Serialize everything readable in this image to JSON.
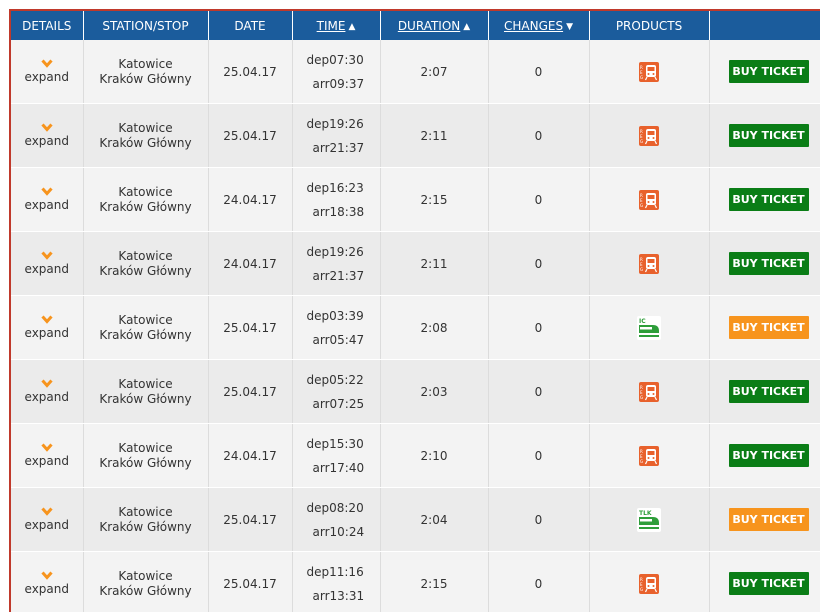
{
  "columns": {
    "details": "DETAILS",
    "station": "STATION/STOP",
    "date": "DATE",
    "time": "TIME",
    "duration": "DURATION",
    "changes": "CHANGES",
    "products": "PRODUCTS",
    "buy": ""
  },
  "colors": {
    "header_bg": "#1b5c9c",
    "green_button": "#0a7d16",
    "orange_button": "#f7941d",
    "chevron": "#f7941d"
  },
  "rows": [
    {
      "expand": "expand",
      "from": "Katowice",
      "to": "Kraków Główny",
      "date": "25.04.17",
      "dep": "dep07:30",
      "arr": "arr09:37",
      "duration": "2:07",
      "changes": "0",
      "product": "REG",
      "product_icon": "reg-train-icon",
      "buy": "BUY TICKET",
      "buy_style": "green"
    },
    {
      "expand": "expand",
      "from": "Katowice",
      "to": "Kraków Główny",
      "date": "25.04.17",
      "dep": "dep19:26",
      "arr": "arr21:37",
      "duration": "2:11",
      "changes": "0",
      "product": "REG",
      "product_icon": "reg-train-icon",
      "buy": "BUY TICKET",
      "buy_style": "green"
    },
    {
      "expand": "expand",
      "from": "Katowice",
      "to": "Kraków Główny",
      "date": "24.04.17",
      "dep": "dep16:23",
      "arr": "arr18:38",
      "duration": "2:15",
      "changes": "0",
      "product": "REG",
      "product_icon": "reg-train-icon",
      "buy": "BUY TICKET",
      "buy_style": "green"
    },
    {
      "expand": "expand",
      "from": "Katowice",
      "to": "Kraków Główny",
      "date": "24.04.17",
      "dep": "dep19:26",
      "arr": "arr21:37",
      "duration": "2:11",
      "changes": "0",
      "product": "REG",
      "product_icon": "reg-train-icon",
      "buy": "BUY TICKET",
      "buy_style": "green"
    },
    {
      "expand": "expand",
      "from": "Katowice",
      "to": "Kraków Główny",
      "date": "25.04.17",
      "dep": "dep03:39",
      "arr": "arr05:47",
      "duration": "2:08",
      "changes": "0",
      "product": "IC",
      "product_icon": "ic-train-icon",
      "buy": "BUY TICKET",
      "buy_style": "orange"
    },
    {
      "expand": "expand",
      "from": "Katowice",
      "to": "Kraków Główny",
      "date": "25.04.17",
      "dep": "dep05:22",
      "arr": "arr07:25",
      "duration": "2:03",
      "changes": "0",
      "product": "REG",
      "product_icon": "reg-train-icon",
      "buy": "BUY TICKET",
      "buy_style": "green"
    },
    {
      "expand": "expand",
      "from": "Katowice",
      "to": "Kraków Główny",
      "date": "24.04.17",
      "dep": "dep15:30",
      "arr": "arr17:40",
      "duration": "2:10",
      "changes": "0",
      "product": "REG",
      "product_icon": "reg-train-icon",
      "buy": "BUY TICKET",
      "buy_style": "green"
    },
    {
      "expand": "expand",
      "from": "Katowice",
      "to": "Kraków Główny",
      "date": "25.04.17",
      "dep": "dep08:20",
      "arr": "arr10:24",
      "duration": "2:04",
      "changes": "0",
      "product": "TLK",
      "product_icon": "tlk-train-icon",
      "buy": "BUY TICKET",
      "buy_style": "orange"
    },
    {
      "expand": "expand",
      "from": "Katowice",
      "to": "Kraków Główny",
      "date": "25.04.17",
      "dep": "dep11:16",
      "arr": "arr13:31",
      "duration": "2:15",
      "changes": "0",
      "product": "REG",
      "product_icon": "reg-train-icon",
      "buy": "BUY TICKET",
      "buy_style": "green"
    }
  ]
}
